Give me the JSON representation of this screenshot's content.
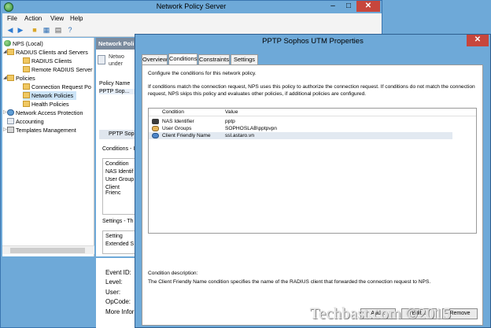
{
  "nps_window": {
    "title": "Network Policy Server",
    "controls": {
      "minimize": "–",
      "maximize": "□",
      "close": "✕"
    },
    "menu": [
      "File",
      "Action",
      "View",
      "Help"
    ],
    "tree": [
      {
        "label": "NPS (Local)",
        "icon": "globe-icon"
      },
      {
        "label": "RADIUS Clients and Servers",
        "icon": "folder-icon"
      },
      {
        "label": "RADIUS Clients",
        "icon": "folder-icon"
      },
      {
        "label": "Remote RADIUS Server",
        "icon": "folder-icon"
      },
      {
        "label": "Policies",
        "icon": "folder-icon"
      },
      {
        "label": "Connection Request Po",
        "icon": "folder-icon"
      },
      {
        "label": "Network Policies",
        "icon": "folder-icon",
        "selected": true
      },
      {
        "label": "Health Policies",
        "icon": "folder-icon"
      },
      {
        "label": "Network Access Protection",
        "icon": "network-icon"
      },
      {
        "label": "Accounting",
        "icon": "doc-icon"
      },
      {
        "label": "Templates Management",
        "icon": "template-icon"
      }
    ],
    "middle": {
      "header": "Network Poli",
      "info_line1": "Netwo",
      "info_line2": "under",
      "column_header": "Policy Name",
      "policy_row": "PPTP Sop...",
      "detail_header": "PPTP Soph",
      "conditions_header": "Conditions - I",
      "conditions": [
        "Condition",
        "NAS Identif",
        "User Group",
        "Client Frienc"
      ],
      "settings_header": "Settings - Th",
      "settings": [
        "Setting",
        "Extended S"
      ]
    },
    "event_labels": [
      "Event ID:",
      "Level:",
      "User:",
      "OpCode:",
      "More Inforr"
    ]
  },
  "dialog": {
    "title": "PPTP Sophos UTM Properties",
    "close": "✕",
    "tabs": [
      "Overview",
      "Conditions",
      "Constraints",
      "Settings"
    ],
    "active_tab": "Conditions",
    "intro": "Configure the conditions for this network policy.",
    "description": "If conditions match the connection request, NPS uses this policy to authorize the connection request. If conditions do not match the connection request, NPS skips this policy and evaluates other policies, if additional policies are configured.",
    "table": {
      "headers": [
        "Condition",
        "Value"
      ],
      "rows": [
        {
          "condition": "NAS Identifier",
          "value": "pptp",
          "icon": "nas-icon"
        },
        {
          "condition": "User Groups",
          "value": "SOPHOSLAB\\pptpvpn",
          "icon": "user-group-icon"
        },
        {
          "condition": "Client Friendly Name",
          "value": "ssl.astaro.vn",
          "icon": "client-icon",
          "selected": true
        }
      ]
    },
    "condition_description_label": "Condition description:",
    "condition_description": "The Client Friendly Name condition specifies the name of the RADIUS client that forwarded the connection request to NPS.",
    "buttons": {
      "add": "Add...",
      "edit": "Edit...",
      "remove": "Remove"
    }
  },
  "watermark": "Techbast.com ©2015"
}
